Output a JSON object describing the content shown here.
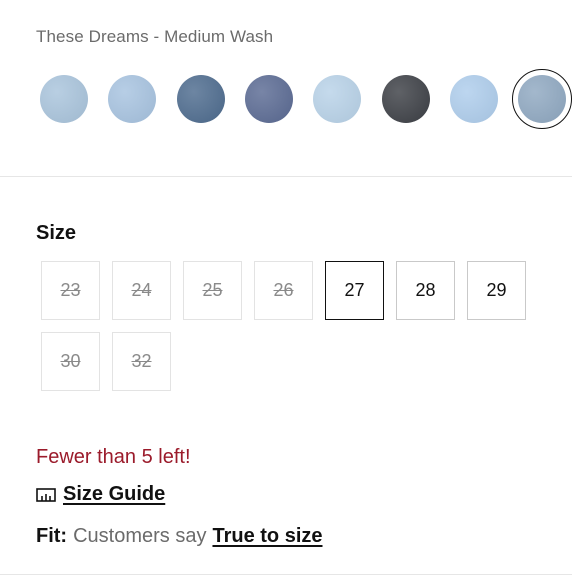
{
  "product": {
    "color_name": "These Dreams - Medium Wash"
  },
  "swatches": [
    {
      "name": "light-wash-1",
      "color": "#a9c4dc",
      "selected": false
    },
    {
      "name": "light-wash-2",
      "color": "#a7c3e0",
      "selected": false
    },
    {
      "name": "dark-wash-1",
      "color": "#4d6b8e",
      "selected": false
    },
    {
      "name": "dark-wash-2",
      "color": "#5a6a93",
      "selected": false
    },
    {
      "name": "pale-wash",
      "color": "#b8d2e8",
      "selected": false
    },
    {
      "name": "black-wash",
      "color": "#3c3f45",
      "selected": false
    },
    {
      "name": "bright-light-wash",
      "color": "#aecdec",
      "selected": false
    },
    {
      "name": "medium-wash",
      "color": "#8fa8c1",
      "selected": true
    }
  ],
  "size": {
    "heading": "Size",
    "options": [
      {
        "label": "23",
        "status": "unavailable"
      },
      {
        "label": "24",
        "status": "unavailable"
      },
      {
        "label": "25",
        "status": "unavailable"
      },
      {
        "label": "26",
        "status": "unavailable"
      },
      {
        "label": "27",
        "status": "selected"
      },
      {
        "label": "28",
        "status": "available"
      },
      {
        "label": "29",
        "status": "available"
      },
      {
        "label": "30",
        "status": "unavailable"
      },
      {
        "label": "32",
        "status": "unavailable"
      }
    ]
  },
  "stock_message": "Fewer than 5 left!",
  "size_guide": {
    "label": "Size Guide",
    "icon": "ruler-icon"
  },
  "fit": {
    "label": "Fit:",
    "text": "Customers say",
    "link": "True to size"
  },
  "colors": {
    "stock_warning": "#9b1b2b",
    "muted_text": "#6b6b6b",
    "selected_border": "#111111"
  }
}
